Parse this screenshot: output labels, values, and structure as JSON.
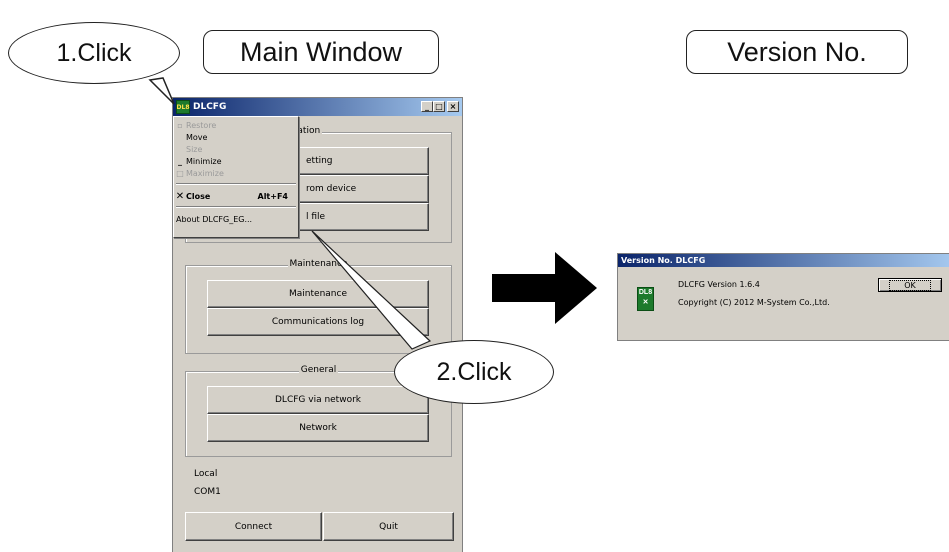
{
  "annotations": {
    "step1": "1.Click",
    "step2": "2.Click",
    "main_window_caption": "Main Window",
    "version_caption": "Version No."
  },
  "main_window": {
    "title": "DLCFG",
    "title_buttons": [
      "_",
      "□",
      "×"
    ],
    "config_group": {
      "title": "uration",
      "buttons": [
        "etting",
        "rom device",
        "l file"
      ]
    },
    "maintenance_group": {
      "title": "Maintenance",
      "buttons": [
        "Maintenance",
        "Communications log"
      ]
    },
    "general_group": {
      "title": "General",
      "buttons": [
        "DLCFG via network",
        "Network"
      ]
    },
    "status": [
      "Local",
      "COM1"
    ],
    "footer_buttons": [
      "Connect",
      "Quit"
    ]
  },
  "system_menu": {
    "items": [
      {
        "label": "Restore",
        "disabled": true,
        "icon": "restore-icon"
      },
      {
        "label": "Move",
        "disabled": false
      },
      {
        "label": "Size",
        "disabled": true
      },
      {
        "label": "Minimize",
        "disabled": false,
        "icon": "minimize-icon"
      },
      {
        "label": "Maximize",
        "disabled": true,
        "icon": "maximize-icon"
      },
      {
        "label": "Close",
        "accelerator": "Alt+F4",
        "bold": true,
        "icon": "close-icon"
      },
      {
        "label": "About DLCFG_EG..."
      }
    ]
  },
  "version_dialog": {
    "title": "Version No. DLCFG",
    "version_text": "DLCFG Version 1.6.4",
    "copyright": "Copyright (C) 2012 M-System Co.,Ltd.",
    "ok_label": "OK",
    "icon_text": "DL8"
  },
  "colors": {
    "titlebar_start": "#0a246a",
    "titlebar_end": "#a6caf0",
    "window_face": "#d4d0c8",
    "icon_green": "#1d7a2c"
  }
}
